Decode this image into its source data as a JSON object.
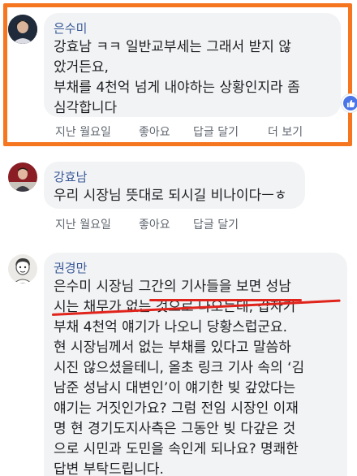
{
  "comments": [
    {
      "author": "은수미",
      "lines": [
        "강효남 ㅋㅋ 일반교부세는 그래서 받지 않",
        "았거든요,",
        "부채를 4천억 넘게 내야하는 상황인지라 좀",
        "심각합니다"
      ],
      "actions": [
        "지난 월요일",
        "좋아요",
        "답글 달기",
        "더 보기"
      ]
    },
    {
      "author": "강효남",
      "lines": [
        "우리 시장님 뜻대로 되시길 비나이다ㅡㅎ"
      ],
      "actions": [
        "지난 월요일",
        "좋아요",
        "답글 달기"
      ]
    },
    {
      "author": "권경만",
      "lines": [
        "은수미 시장님 그간의 기사들을 보면 성남",
        "시는 채무가 없는 것으로 나오는데, 갑자기",
        "부채 4천억 얘기가 나오니 당황스럽군요.",
        "현 시장님께서 없는 부채를 있다고 말씀하",
        "시진 않으셨을테니, 올초 링크 기사 속의 ‘김",
        "남준 성남시 대변인’이 얘기한 빚 갚았다는",
        "얘기는 거짓인가요? 그럼 전임 시장인 이재",
        "명 현 경기도지사측은 그동안 빚 다갚은 것",
        "으로 시민과 도민을 속인게 되나요? 명쾌한",
        "답변 부탁드립니다."
      ]
    }
  ],
  "colors": {
    "highlight": "#f5761f",
    "link": "#385898",
    "ink": "#e0241c",
    "like": "#4a76e8"
  }
}
